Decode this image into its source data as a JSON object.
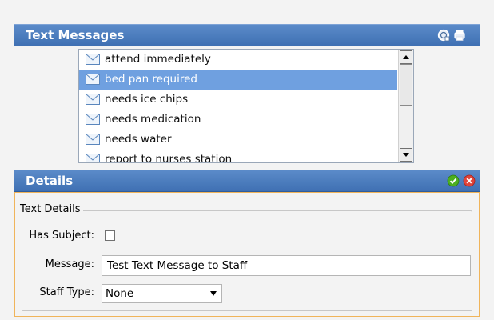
{
  "messages_panel": {
    "title": "Text Messages",
    "icons": [
      "add-icon",
      "print-icon"
    ],
    "items": [
      {
        "label": "attend immediately",
        "selected": false
      },
      {
        "label": "bed pan required",
        "selected": true
      },
      {
        "label": "needs ice chips",
        "selected": false
      },
      {
        "label": "needs medication",
        "selected": false
      },
      {
        "label": "needs water",
        "selected": false
      },
      {
        "label": "report to nurses station",
        "selected": false
      }
    ]
  },
  "details_panel": {
    "title": "Details",
    "icons": [
      "confirm-icon",
      "cancel-icon"
    ],
    "group_label": "Text Details",
    "has_subject": {
      "label": "Has Subject:",
      "checked": false
    },
    "message": {
      "label": "Message:",
      "value": "Test Text Message to Staff"
    },
    "staff_type": {
      "label": "Staff Type:",
      "value": "None"
    }
  },
  "colors": {
    "header": "#4a7cc0",
    "selection": "#6fa0e0",
    "details_border": "#f0b45a",
    "confirm": "#4caf1e",
    "cancel": "#e0443a"
  }
}
